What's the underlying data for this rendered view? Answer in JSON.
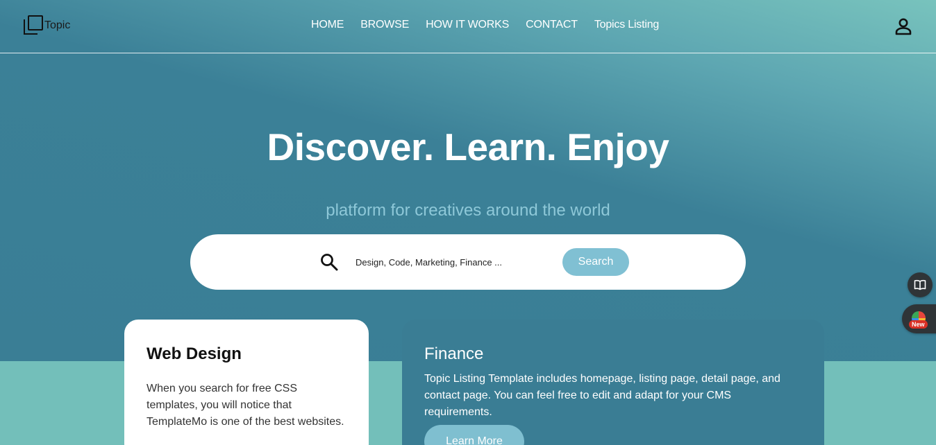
{
  "brand": {
    "name": "Topic",
    "icon": "stacked-squares-icon"
  },
  "nav": {
    "items": [
      {
        "label": "HOME"
      },
      {
        "label": "BROWSE"
      },
      {
        "label": "HOW IT WORKS"
      },
      {
        "label": "CONTACT"
      },
      {
        "label": "Topics Listing"
      }
    ],
    "user_icon": "user-icon"
  },
  "hero": {
    "headline": "Discover. Learn. Enjoy",
    "subline": "platform for creatives around the world"
  },
  "search": {
    "icon": "search-icon",
    "placeholder": "Design, Code, Marketing, Finance ...",
    "value": "",
    "button_label": "Search"
  },
  "cards": {
    "web_design": {
      "title": "Web Design",
      "text": "When you search for free CSS templates, you will notice that TemplateMo is one of the best websites."
    },
    "finance": {
      "title": "Finance",
      "text": "Topic Listing Template includes homepage, listing page, detail page, and contact page. You can feel free to edit and adapt for your CMS requirements.",
      "button_label": "Learn More"
    }
  },
  "side_widgets": {
    "book_icon": "book-icon",
    "new_badge": "New"
  },
  "colors": {
    "hero_bg": "#3a7e95",
    "band_bg": "#73bfba",
    "accent_button": "#80c0d3",
    "finance_card": "#3a7d94"
  }
}
